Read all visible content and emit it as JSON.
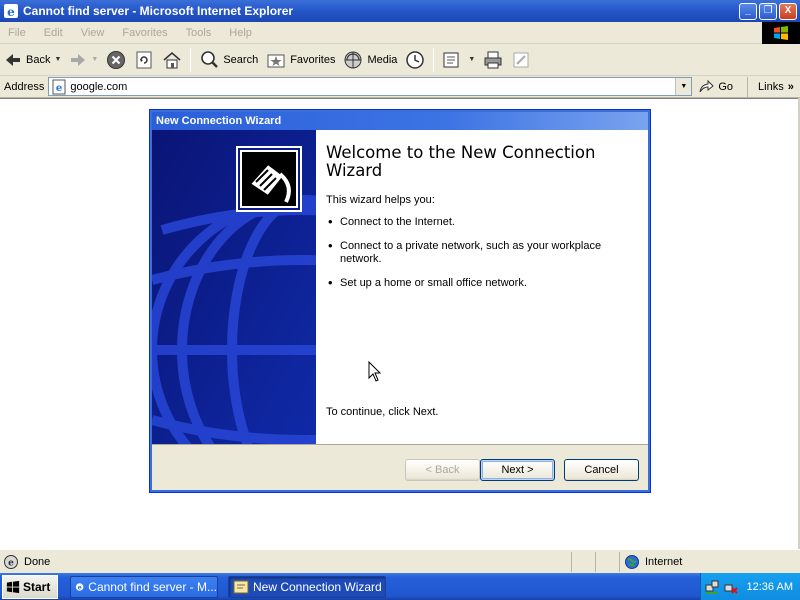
{
  "window": {
    "title": "Cannot find server - Microsoft Internet Explorer",
    "buttons": {
      "minimize": "_",
      "maximize": "❐",
      "close": "X"
    }
  },
  "menu": [
    "File",
    "Edit",
    "View",
    "Favorites",
    "Tools",
    "Help"
  ],
  "toolbar": {
    "back": "Back",
    "search": "Search",
    "favorites": "Favorites",
    "media": "Media"
  },
  "address": {
    "label": "Address",
    "url": "google.com",
    "go": "Go",
    "links": "Links",
    "links_chevron": "»"
  },
  "wizard": {
    "title": "New Connection Wizard",
    "heading": "Welcome to the New Connection Wizard",
    "intro": "This wizard helps you:",
    "bullets": [
      "Connect to the Internet.",
      "Connect to a private network, such as your workplace network.",
      "Set up a home or small office network."
    ],
    "continue_text": "To continue, click Next.",
    "buttons": {
      "back": "< Back",
      "next": "Next >",
      "cancel": "Cancel"
    }
  },
  "status": {
    "text": "Done",
    "zone": "Internet"
  },
  "taskbar": {
    "start": "Start",
    "tasks": [
      "Cannot find server - M...",
      "New Connection Wizard"
    ],
    "clock": "12:36 AM"
  },
  "colors": {
    "title_bar": "#2456c9",
    "chrome": "#ece9d8",
    "wizard_side": "#0b1a8f",
    "taskbar": "#2057d0"
  }
}
